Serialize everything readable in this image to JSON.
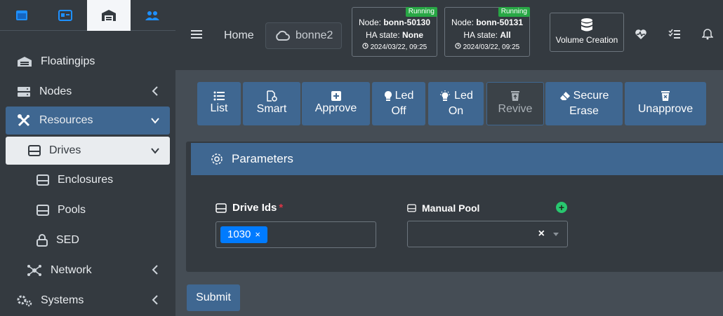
{
  "sidebar": {
    "tabs": [
      "window-icon",
      "id-card-icon",
      "warehouse-icon",
      "users-icon"
    ],
    "items": [
      {
        "label": "Floatingips"
      },
      {
        "label": "Nodes"
      },
      {
        "label": "Resources"
      },
      {
        "label": "Drives"
      },
      {
        "label": "Enclosures"
      },
      {
        "label": "Pools"
      },
      {
        "label": "SED"
      },
      {
        "label": "Network"
      },
      {
        "label": "Systems"
      }
    ]
  },
  "topbar": {
    "home": "Home",
    "cluster": "bonne2",
    "nodes": [
      {
        "node_prefix": "Node: ",
        "node": "bonn-50130",
        "ha_prefix": "HA state: ",
        "ha": "None",
        "time": "2024/03/22, 09:25",
        "status": "Running"
      },
      {
        "node_prefix": "Node: ",
        "node": "bonn-50131",
        "ha_prefix": "HA state: ",
        "ha": "All",
        "time": "2024/03/22, 09:25",
        "status": "Running"
      }
    ],
    "volume_creation": "Volume Creation"
  },
  "toolbar": {
    "list": "List",
    "smart": "Smart",
    "approve": "Approve",
    "led_off_1": "Led",
    "led_off_2": "Off",
    "led_on_1": "Led",
    "led_on_2": "On",
    "revive": "Revive",
    "secure_erase_1": "Secure",
    "secure_erase_2": "Erase",
    "unapprove": "Unapprove"
  },
  "form": {
    "title": "Parameters",
    "drive_ids_label": "Drive Ids",
    "required_mark": "*",
    "drive_ids_value": "1030",
    "manual_pool_label": "Manual Pool",
    "clear": "×",
    "submit": "Submit"
  },
  "colors": {
    "accent": "#3f6791",
    "sidebar_bg": "#343a40",
    "content_bg": "#454d55",
    "tag": "#007bff",
    "running": "#28a745"
  }
}
